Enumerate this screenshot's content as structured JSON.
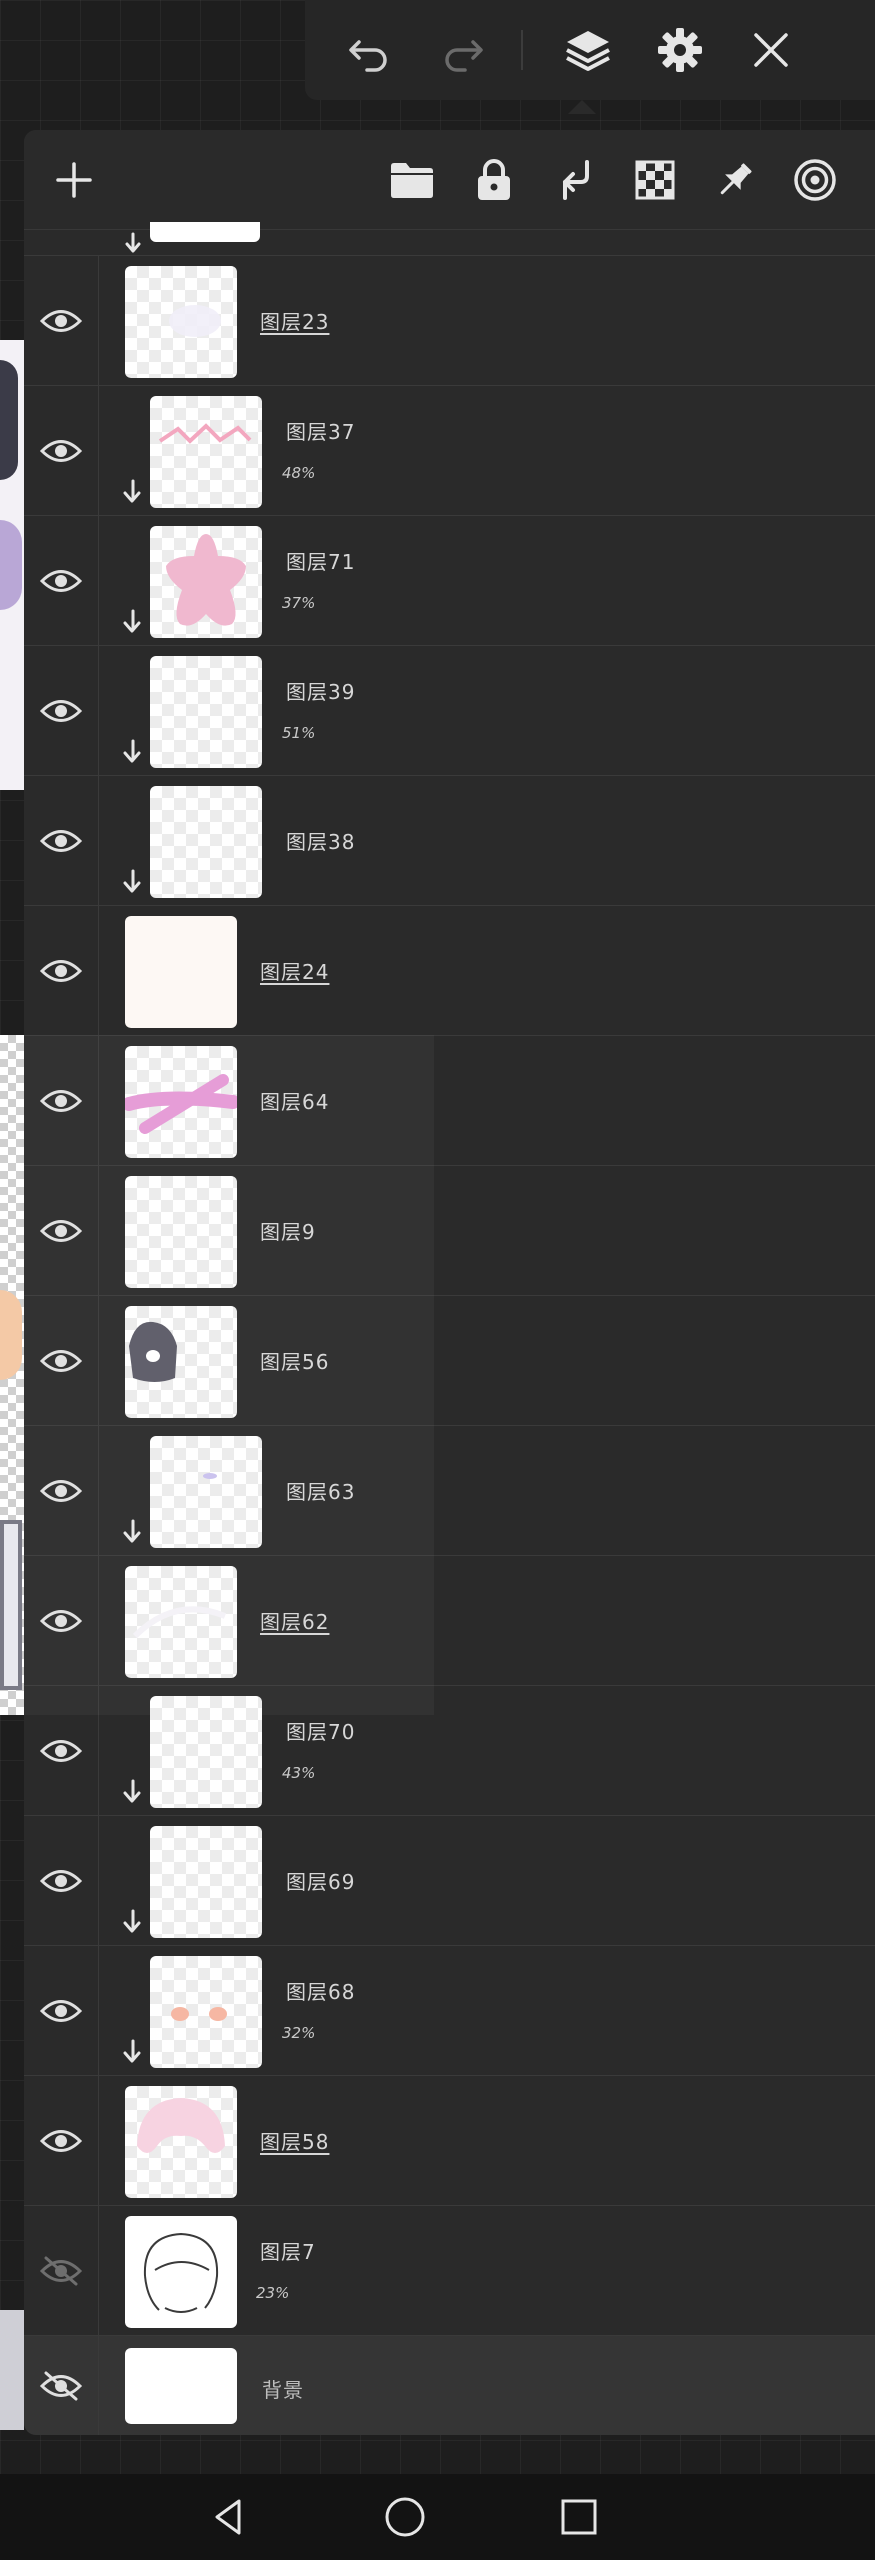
{
  "toolbar": {
    "undo_icon": "undo-icon",
    "redo_icon": "redo-icon",
    "layers_icon": "layers-icon",
    "settings_icon": "gear-icon",
    "close_icon": "close-icon"
  },
  "panel_actions": {
    "add_icon": "plus-icon",
    "folder_icon": "folder-icon",
    "lock_icon": "lock-icon",
    "clip_icon": "clipping-mask-icon",
    "transparency_icon": "checkerboard-icon",
    "pin_icon": "pin-icon",
    "target_icon": "target-icon"
  },
  "layers": [
    {
      "name": "图层23",
      "opacity": "",
      "clipped": false,
      "visible": true,
      "underlined": true
    },
    {
      "name": "图层37",
      "opacity": "48%",
      "clipped": true,
      "visible": true,
      "underlined": false
    },
    {
      "name": "图层71",
      "opacity": "37%",
      "clipped": true,
      "visible": true,
      "underlined": false
    },
    {
      "name": "图层39",
      "opacity": "51%",
      "clipped": true,
      "visible": true,
      "underlined": false
    },
    {
      "name": "图层38",
      "opacity": "",
      "clipped": true,
      "visible": true,
      "underlined": false
    },
    {
      "name": "图层24",
      "opacity": "",
      "clipped": false,
      "visible": true,
      "underlined": true
    },
    {
      "name": "图层64",
      "opacity": "",
      "clipped": false,
      "visible": true,
      "underlined": false
    },
    {
      "name": "图层9",
      "opacity": "",
      "clipped": false,
      "visible": true,
      "underlined": false
    },
    {
      "name": "图层56",
      "opacity": "",
      "clipped": false,
      "visible": true,
      "underlined": false
    },
    {
      "name": "图层63",
      "opacity": "",
      "clipped": true,
      "visible": true,
      "underlined": false
    },
    {
      "name": "图层62",
      "opacity": "",
      "clipped": false,
      "visible": true,
      "underlined": true
    },
    {
      "name": "图层70",
      "opacity": "43%",
      "clipped": true,
      "visible": true,
      "underlined": false
    },
    {
      "name": "图层69",
      "opacity": "",
      "clipped": true,
      "visible": true,
      "underlined": false
    },
    {
      "name": "图层68",
      "opacity": "32%",
      "clipped": true,
      "visible": true,
      "underlined": false
    },
    {
      "name": "图层58",
      "opacity": "",
      "clipped": false,
      "visible": true,
      "underlined": true
    },
    {
      "name": "图层7",
      "opacity": "23%",
      "clipped": false,
      "visible": false,
      "underlined": false
    }
  ],
  "background_layer": {
    "name": "背景",
    "visible": false
  },
  "nav": {
    "back_icon": "back-triangle-icon",
    "home_icon": "home-circle-icon",
    "recents_icon": "recents-square-icon"
  },
  "colors": {
    "panel_bg": "#2a2a2a",
    "toolbar_bg": "#262626",
    "text": "#d7d7d7",
    "nav_bg": "#131313"
  }
}
